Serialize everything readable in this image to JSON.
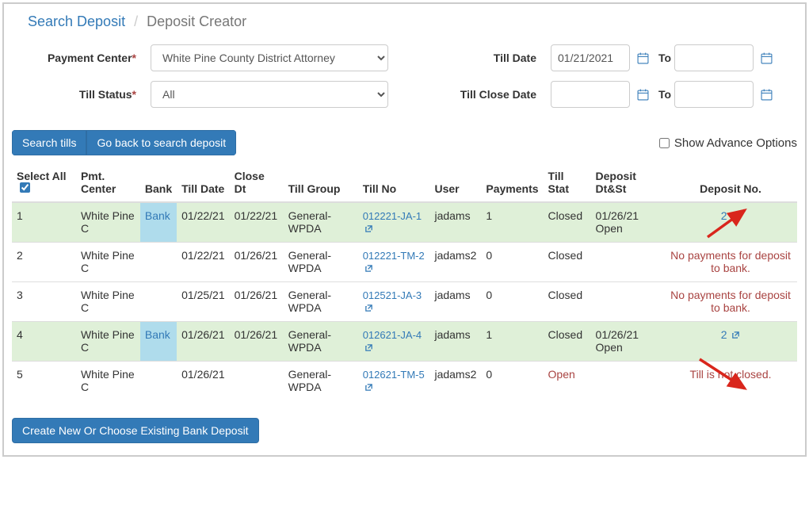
{
  "breadcrumb": {
    "link": "Search Deposit",
    "current": "Deposit Creator"
  },
  "filters": {
    "payment_center_label": "Payment Center",
    "payment_center_value": "White Pine County District Attorney",
    "till_status_label": "Till Status",
    "till_status_value": "All",
    "till_date_label": "Till Date",
    "till_date_from": "01/21/2021",
    "till_date_to_label": "To",
    "till_date_to": "",
    "till_close_date_label": "Till Close Date",
    "till_close_date_from": "",
    "till_close_date_to_label": "To",
    "till_close_date_to": ""
  },
  "buttons": {
    "search_tills": "Search tills",
    "go_back": "Go back to search deposit",
    "show_adv": "Show Advance Options",
    "create_new": "Create New Or Choose Existing Bank Deposit"
  },
  "columns": {
    "select_all": "Select All",
    "pmt_center": "Pmt. Center",
    "bank": "Bank",
    "till_date": "Till Date",
    "close_dt": "Close Dt",
    "till_group": "Till Group",
    "till_no": "Till No",
    "user": "User",
    "payments": "Payments",
    "till_stat": "Till Stat",
    "deposit_dtst": "Deposit Dt&St",
    "deposit_no": "Deposit No."
  },
  "rows": [
    {
      "id": "1",
      "pmt_center": "White Pine C",
      "bank": "Bank",
      "till_date": "01/22/21",
      "close_dt": "01/22/21",
      "till_group": "General-WPDA",
      "till_no": "012221-JA-1",
      "user": "jadams",
      "payments": "1",
      "till_stat": "Closed",
      "deposit_dtst": "01/26/21 Open",
      "deposit_no": "2",
      "highlight": true,
      "has_bank": true,
      "stat_red": false,
      "deposit_link": true
    },
    {
      "id": "2",
      "pmt_center": "White Pine C",
      "bank": "",
      "till_date": "01/22/21",
      "close_dt": "01/26/21",
      "till_group": "General-WPDA",
      "till_no": "012221-TM-2",
      "user": "jadams2",
      "payments": "0",
      "till_stat": "Closed",
      "deposit_dtst": "",
      "deposit_no": "No payments for deposit to bank.",
      "highlight": false,
      "has_bank": false,
      "stat_red": false,
      "deposit_link": false
    },
    {
      "id": "3",
      "pmt_center": "White Pine C",
      "bank": "",
      "till_date": "01/25/21",
      "close_dt": "01/26/21",
      "till_group": "General-WPDA",
      "till_no": "012521-JA-3",
      "user": "jadams",
      "payments": "0",
      "till_stat": "Closed",
      "deposit_dtst": "",
      "deposit_no": "No payments for deposit to bank.",
      "highlight": false,
      "has_bank": false,
      "stat_red": false,
      "deposit_link": false
    },
    {
      "id": "4",
      "pmt_center": "White Pine C",
      "bank": "Bank",
      "till_date": "01/26/21",
      "close_dt": "01/26/21",
      "till_group": "General-WPDA",
      "till_no": "012621-JA-4",
      "user": "jadams",
      "payments": "1",
      "till_stat": "Closed",
      "deposit_dtst": "01/26/21 Open",
      "deposit_no": "2",
      "highlight": true,
      "has_bank": true,
      "stat_red": false,
      "deposit_link": true
    },
    {
      "id": "5",
      "pmt_center": "White Pine C",
      "bank": "",
      "till_date": "01/26/21",
      "close_dt": "",
      "till_group": "General-WPDA",
      "till_no": "012621-TM-5",
      "user": "jadams2",
      "payments": "0",
      "till_stat": "Open",
      "deposit_dtst": "",
      "deposit_no": "Till is not closed.",
      "highlight": false,
      "has_bank": false,
      "stat_red": true,
      "deposit_link": false
    }
  ]
}
